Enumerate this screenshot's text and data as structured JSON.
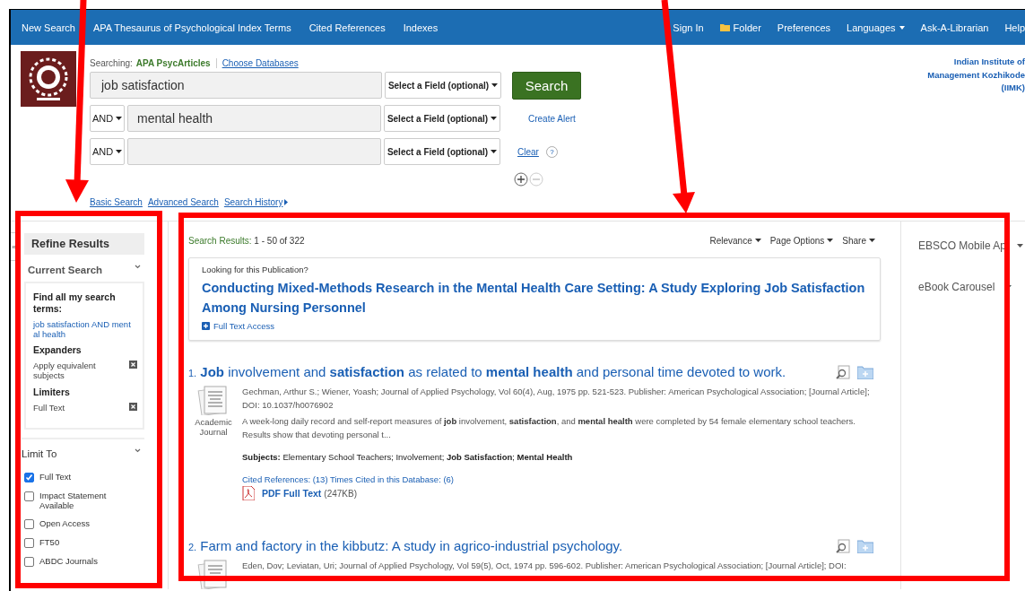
{
  "nav": {
    "left": [
      {
        "label": "New Search"
      },
      {
        "label": "APA Thesaurus of Psychological Index Terms"
      },
      {
        "label": "Cited References"
      },
      {
        "label": "Indexes"
      }
    ],
    "right": [
      {
        "label": "Sign In",
        "kind": "plain"
      },
      {
        "label": "Folder",
        "kind": "folder"
      },
      {
        "label": "Preferences",
        "kind": "plain"
      },
      {
        "label": "Languages",
        "kind": "menu"
      },
      {
        "label": "Ask-A-Librarian",
        "kind": "plain"
      },
      {
        "label": "Help",
        "kind": "plain"
      }
    ]
  },
  "search": {
    "searching_label": "Searching:",
    "database": "APA PsycArticles",
    "choose_link": "Choose Databases",
    "rows": [
      {
        "value": "job satisfaction",
        "field": "Select a Field (optional)"
      },
      {
        "operator": "AND",
        "value": "mental health",
        "field": "Select a Field (optional)"
      },
      {
        "operator": "AND",
        "value": "",
        "field": "Select a Field (optional)"
      }
    ],
    "button": "Search",
    "create_alert": "Create Alert",
    "clear": "Clear",
    "help": "?",
    "links": [
      {
        "label": "Basic Search",
        "kind": "link"
      },
      {
        "label": "Advanced Search",
        "kind": "link"
      },
      {
        "label": "Search History",
        "kind": "menu"
      }
    ]
  },
  "institution": [
    "Indian Institute of",
    "Management Kozhikode",
    "(IIMK)"
  ],
  "sidebar": {
    "collapse": "«",
    "title": "Refine Results",
    "current_search": {
      "heading": "Current Search",
      "find_label": "Find all my search terms:",
      "terms": "job satisfaction AND ment al health",
      "groups": [
        {
          "heading": "Expanders",
          "items": [
            "Apply equivalent subjects"
          ]
        },
        {
          "heading": "Limiters",
          "items": [
            "Full Text"
          ]
        }
      ]
    },
    "limit_to": {
      "heading": "Limit To",
      "options": [
        {
          "label": "Full Text",
          "checked": true
        },
        {
          "label": "Impact Statement Available",
          "checked": false
        },
        {
          "label": "Open Access",
          "checked": false
        },
        {
          "label": "FT50",
          "checked": false
        },
        {
          "label": "ABDC Journals",
          "checked": false
        }
      ]
    }
  },
  "results": {
    "summary_label": "Search Results:",
    "summary_range": "1 - 50 of 322",
    "tools": [
      "Relevance",
      "Page Options",
      "Share"
    ],
    "publication": {
      "prompt": "Looking for this Publication?",
      "title": "Conducting Mixed-Methods Research in the Mental Health Care Setting: A Study Exploring Job Satisfaction Among Nursing Personnel",
      "access": "Full Text Access"
    },
    "items": [
      {
        "number": "1.",
        "title": "**Job** involvement and **satisfaction** as related to **mental health** and personal time devoted to work.",
        "type": "Academic Journal",
        "citation": "Gechman, Arthur S.; Wiener, Yoash; Journal of Applied Psychology, Vol 60(4), Aug, 1975 pp. 521-523. Publisher: American Psychological Association; [Journal Article]; DOI: 10.1037/h0076902",
        "abstract": "A week-long daily record and self-report measures of **job** involvement, **satisfaction**, and **mental health** were completed by 54 female elementary school teachers. Results show that devoting personal t...",
        "subjects": "**Subjects:** Elementary School Teachers; Involvement; **Job Satisfaction**; **Mental Health**",
        "cited": "Cited References: (13) Times Cited in this Database: (6)",
        "pdf": "PDF Full Text",
        "pdf_size": "(247KB)"
      },
      {
        "number": "2.",
        "title": "Farm and factory in the kibbutz: A study in agrico-industrial psychology.",
        "citation": "Eden, Dov; Leviatan, Uri; Journal of Applied Psychology, Vol 59(5), Oct, 1974 pp. 596-602. Publisher: American Psychological Association; [Journal Article]; DOI:"
      }
    ]
  },
  "right_panel": [
    "EBSCO Mobile Ap",
    "eBook Carousel"
  ]
}
